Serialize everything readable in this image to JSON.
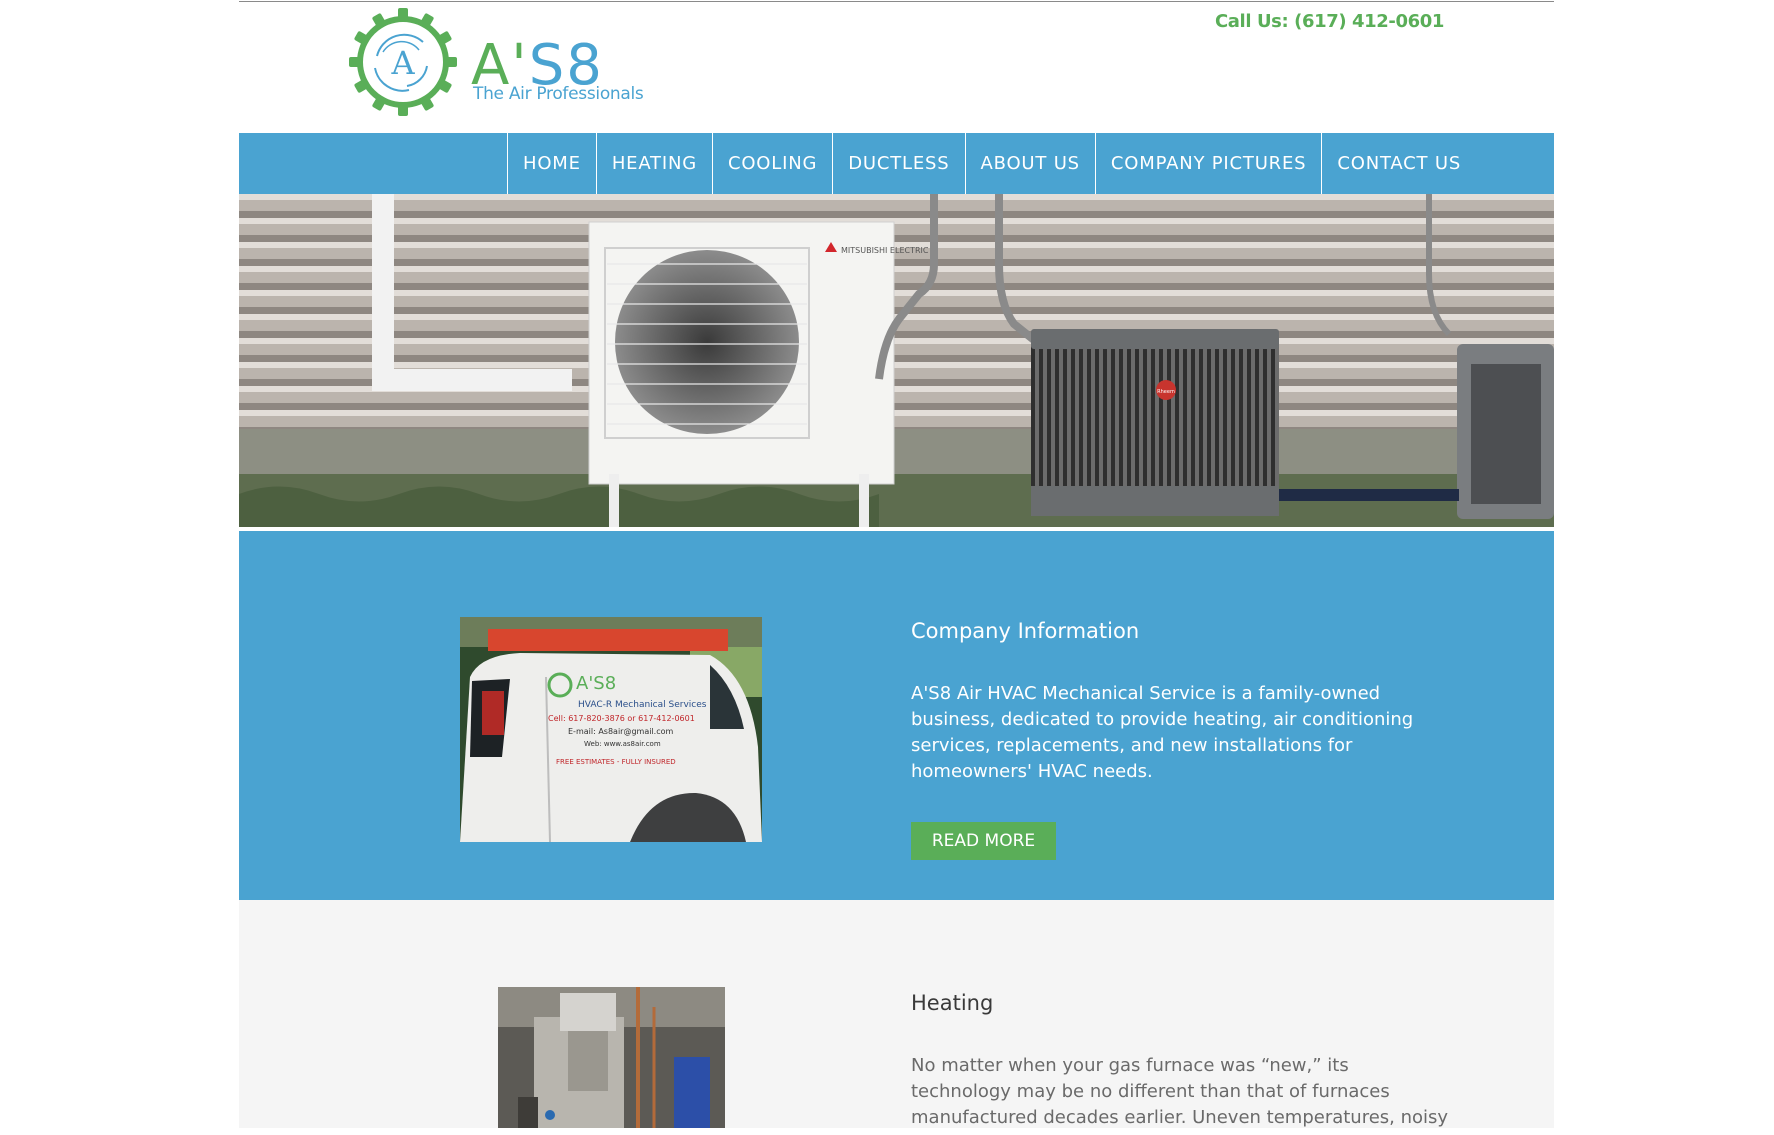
{
  "header": {
    "logo_word_left": "A'",
    "logo_word_right": "S8",
    "logo_tagline": "The Air Professionals",
    "logo_mark": "A",
    "phone": "Call Us: (617) 412-0601"
  },
  "nav": {
    "items": [
      "HOME",
      "HEATING",
      "COOLING",
      "DUCTLESS",
      "ABOUT US",
      "COMPANY PICTURES",
      "CONTACT US"
    ]
  },
  "hero": {
    "unit_brand": "MITSUBISHI ELECTRIC",
    "unit_badge": "Rheem"
  },
  "company_info": {
    "title": "Company Information",
    "text": "A'S8 Air HVAC Mechanical Service is a family-owned business, dedicated to provide heating, air conditioning services, replacements, and new installations for homeowners' HVAC needs.",
    "button": "READ MORE",
    "van_logo": "A'S8",
    "van_lines": [
      "HVAC-R Mechanical Services",
      "Cell: 617-820-3876 or 617-412-0601",
      "E-mail: As8air@gmail.com",
      "Web: www.as8air.com",
      "FREE ESTIMATES - FULLY INSURED"
    ]
  },
  "heating": {
    "title": "Heating",
    "text": "No matter when your gas furnace was “new,” its technology may be no different than that of furnaces manufactured decades earlier. Uneven temperatures, noisy operation and"
  },
  "colors": {
    "brand_blue": "#4aa3d1",
    "brand_green": "#5aae58"
  }
}
